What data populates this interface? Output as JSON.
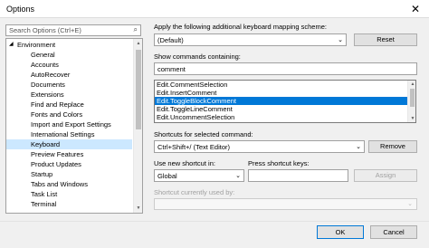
{
  "window": {
    "title": "Options",
    "close_glyph": "✕"
  },
  "sidebar": {
    "search_placeholder": "Search Options (Ctrl+E)",
    "root": "Environment",
    "items": [
      "General",
      "Accounts",
      "AutoRecover",
      "Documents",
      "Extensions",
      "Find and Replace",
      "Fonts and Colors",
      "Import and Export Settings",
      "International Settings",
      "Keyboard",
      "Preview Features",
      "Product Updates",
      "Startup",
      "Tabs and Windows",
      "Task List",
      "Terminal"
    ],
    "selected": "Keyboard"
  },
  "main": {
    "scheme_label": "Apply the following additional keyboard mapping scheme:",
    "scheme_value": "(Default)",
    "reset_label": "Reset",
    "show_commands_label": "Show commands containing:",
    "show_commands_value": "comment",
    "commands": [
      "Edit.CommentSelection",
      "Edit.InsertComment",
      "Edit.ToggleBlockComment",
      "Edit.ToggleLineComment",
      "Edit.UncommentSelection"
    ],
    "selected_command": "Edit.ToggleBlockComment",
    "shortcuts_label": "Shortcuts for selected command:",
    "shortcut_value": "Ctrl+Shift+/ (Text Editor)",
    "remove_label": "Remove",
    "use_shortcut_label": "Use new shortcut in:",
    "use_shortcut_value": "Global",
    "press_keys_label": "Press shortcut keys:",
    "press_keys_value": "",
    "assign_label": "Assign",
    "currently_used_label": "Shortcut currently used by:"
  },
  "footer": {
    "ok_label": "OK",
    "cancel_label": "Cancel"
  }
}
